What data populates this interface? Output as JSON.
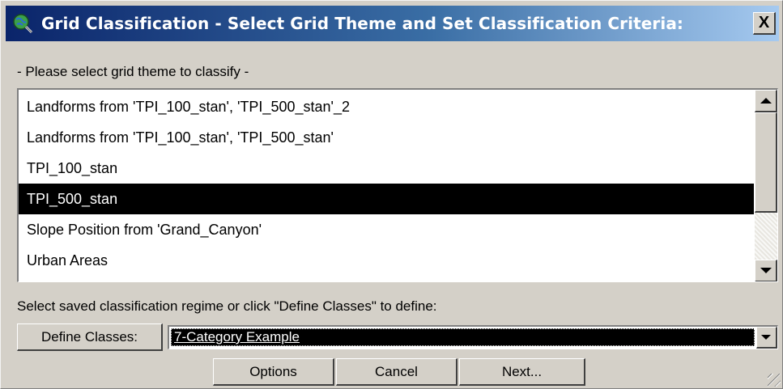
{
  "window": {
    "title": "Grid Classification - Select Grid Theme and Set Classification Criteria:",
    "icon": "globe-magnifier-icon",
    "close_label": "X"
  },
  "theme_prompt": "- Please select grid theme to classify -",
  "themes": [
    {
      "label": "Landforms from 'TPI_100_stan', 'TPI_500_stan'_2",
      "selected": false
    },
    {
      "label": "Landforms from 'TPI_100_stan', 'TPI_500_stan'",
      "selected": false
    },
    {
      "label": "TPI_100_stan",
      "selected": false
    },
    {
      "label": "TPI_500_stan",
      "selected": true
    },
    {
      "label": "Slope Position from 'Grand_Canyon'",
      "selected": false
    },
    {
      "label": "Urban Areas",
      "selected": false
    }
  ],
  "regime_instruction": "Select saved classification regime or click \"Define Classes\" to define:",
  "buttons": {
    "define_classes": "Define Classes:",
    "options": "Options",
    "cancel": "Cancel",
    "next": "Next..."
  },
  "regime_select": {
    "value": "7-Category Example"
  },
  "colors": {
    "face": "#d4d0c8",
    "title_start": "#0a246a",
    "title_end": "#a6caf0",
    "selection": "#000000"
  }
}
